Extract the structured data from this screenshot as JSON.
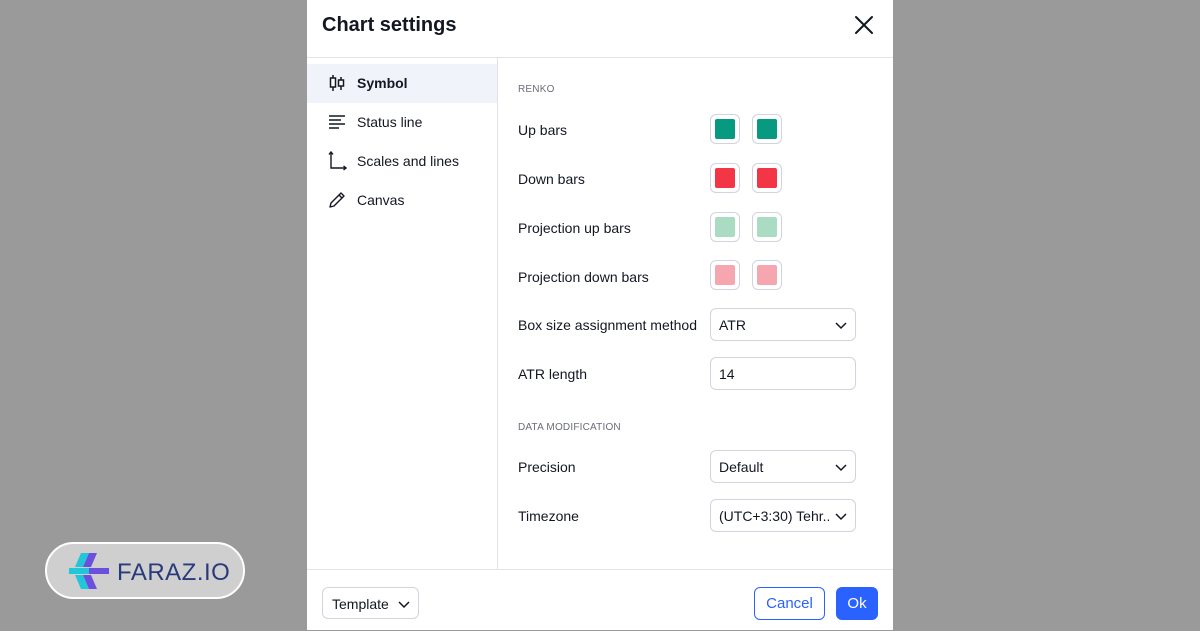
{
  "dialog": {
    "title": "Chart settings"
  },
  "sidebar": {
    "items": [
      {
        "label": "Symbol",
        "icon": "candlestick-icon",
        "active": true
      },
      {
        "label": "Status line",
        "icon": "status-line-icon",
        "active": false
      },
      {
        "label": "Scales and lines",
        "icon": "scales-axis-icon",
        "active": false
      },
      {
        "label": "Canvas",
        "icon": "pencil-icon",
        "active": false
      }
    ]
  },
  "content": {
    "renko_header": "RENKO",
    "up_bars": {
      "label": "Up bars",
      "colors": [
        "#089981",
        "#089981"
      ]
    },
    "down_bars": {
      "label": "Down bars",
      "colors": [
        "#f23645",
        "#f23645"
      ]
    },
    "projection_up_bars": {
      "label": "Projection up bars",
      "colors": [
        "#a9dcc3",
        "#a9dcc3"
      ]
    },
    "projection_down_bars": {
      "label": "Projection down bars",
      "colors": [
        "#f5a6ae",
        "#f5a6ae"
      ]
    },
    "box_size": {
      "label": "Box size assignment method",
      "value": "ATR"
    },
    "atr_length": {
      "label": "ATR length",
      "value": "14"
    },
    "data_mod_header": "DATA MODIFICATION",
    "precision": {
      "label": "Precision",
      "value": "Default"
    },
    "timezone": {
      "label": "Timezone",
      "value": "(UTC+3:30) Tehr..."
    }
  },
  "footer": {
    "template_label": "Template",
    "cancel_label": "Cancel",
    "ok_label": "Ok"
  },
  "brand": {
    "text": "FARAZ.IO"
  },
  "colors": {
    "accent": "#2962ff",
    "overlay": "#9a9a9a"
  }
}
